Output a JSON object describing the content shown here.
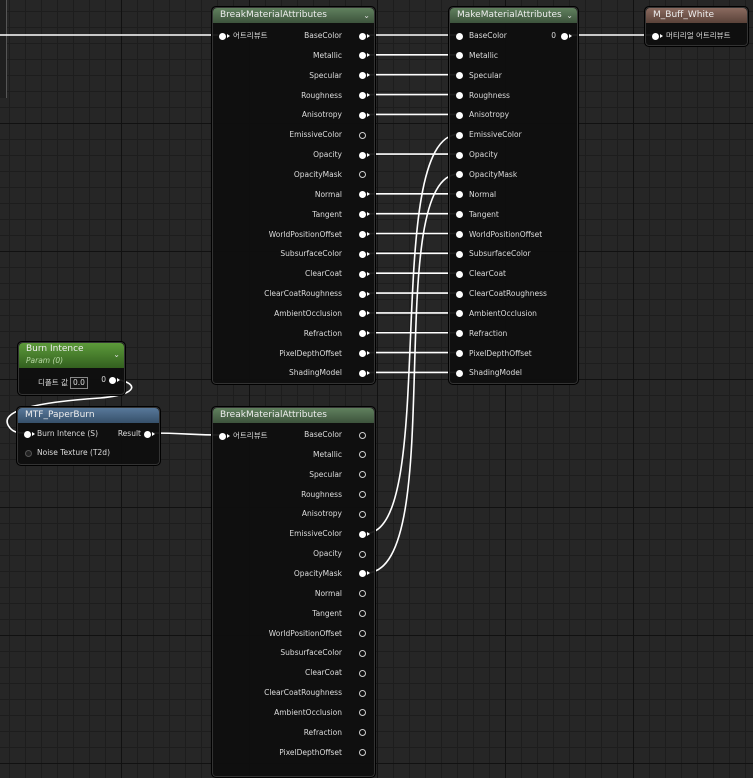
{
  "nodes": {
    "break1": {
      "title": "BreakMaterialAttributes",
      "input": "어트리뷰트",
      "outputs": [
        {
          "label": "BaseColor",
          "on": true
        },
        {
          "label": "Metallic",
          "on": true
        },
        {
          "label": "Specular",
          "on": true
        },
        {
          "label": "Roughness",
          "on": true
        },
        {
          "label": "Anisotropy",
          "on": true
        },
        {
          "label": "EmissiveColor",
          "on": false
        },
        {
          "label": "Opacity",
          "on": true
        },
        {
          "label": "OpacityMask",
          "on": false
        },
        {
          "label": "Normal",
          "on": true
        },
        {
          "label": "Tangent",
          "on": true
        },
        {
          "label": "WorldPositionOffset",
          "on": true
        },
        {
          "label": "SubsurfaceColor",
          "on": true
        },
        {
          "label": "ClearCoat",
          "on": true
        },
        {
          "label": "ClearCoatRoughness",
          "on": true
        },
        {
          "label": "AmbientOcclusion",
          "on": true
        },
        {
          "label": "Refraction",
          "on": true
        },
        {
          "label": "PixelDepthOffset",
          "on": true
        },
        {
          "label": "ShadingModel",
          "on": true
        }
      ]
    },
    "make": {
      "title": "MakeMaterialAttributes",
      "output": "0",
      "inputs": [
        "BaseColor",
        "Metallic",
        "Specular",
        "Roughness",
        "Anisotropy",
        "EmissiveColor",
        "Opacity",
        "OpacityMask",
        "Normal",
        "Tangent",
        "WorldPositionOffset",
        "SubsurfaceColor",
        "ClearCoat",
        "ClearCoatRoughness",
        "AmbientOcclusion",
        "Refraction",
        "PixelDepthOffset",
        "ShadingModel"
      ]
    },
    "result": {
      "title": "M_Buff_White",
      "input": "머티리얼 어트리뷰트"
    },
    "param": {
      "title": "Burn Intence",
      "subtitle": "Param (0)",
      "default_label": "디폴트 값",
      "default_value": "0.0",
      "output": "0"
    },
    "func": {
      "title": "MTF_PaperBurn",
      "inputs": [
        "Burn Intence (S)",
        "Noise Texture (T2d)"
      ],
      "output": "Result"
    },
    "break2": {
      "title": "BreakMaterialAttributes",
      "input": "어트리뷰트",
      "outputs": [
        {
          "label": "BaseColor",
          "on": false
        },
        {
          "label": "Metallic",
          "on": false
        },
        {
          "label": "Specular",
          "on": false
        },
        {
          "label": "Roughness",
          "on": false
        },
        {
          "label": "Anisotropy",
          "on": false
        },
        {
          "label": "EmissiveColor",
          "on": true
        },
        {
          "label": "Opacity",
          "on": false
        },
        {
          "label": "OpacityMask",
          "on": true
        },
        {
          "label": "Normal",
          "on": false
        },
        {
          "label": "Tangent",
          "on": false
        },
        {
          "label": "WorldPositionOffset",
          "on": false
        },
        {
          "label": "SubsurfaceColor",
          "on": false
        },
        {
          "label": "ClearCoat",
          "on": false
        },
        {
          "label": "ClearCoatRoughness",
          "on": false
        },
        {
          "label": "AmbientOcclusion",
          "on": false
        },
        {
          "label": "Refraction",
          "on": false
        },
        {
          "label": "PixelDepthOffset",
          "on": false
        }
      ]
    }
  },
  "colors": {
    "grid_bg": "#262626",
    "wire": "#ffffff",
    "header_break": "#4f6a4d",
    "header_function": "#4a6784",
    "header_result": "#71554b",
    "header_param": "#4a7d2e"
  }
}
